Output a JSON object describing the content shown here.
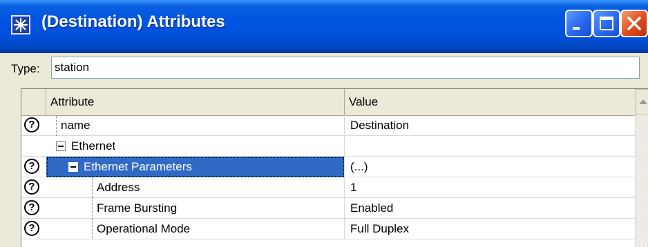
{
  "window": {
    "title": "(Destination) Attributes"
  },
  "type_field": {
    "label": "Type:",
    "value": "station"
  },
  "table": {
    "headers": {
      "attribute": "Attribute",
      "value": "Value"
    },
    "rows": [
      {
        "help": true,
        "indent": 0,
        "expander": false,
        "name": "name",
        "value": "Destination",
        "selected": false
      },
      {
        "help": false,
        "indent": 0,
        "expander": true,
        "name": "Ethernet",
        "value": "",
        "selected": false
      },
      {
        "help": true,
        "indent": 1,
        "expander": true,
        "name": "Ethernet Parameters",
        "value": "(...)",
        "selected": true
      },
      {
        "help": true,
        "indent": 2,
        "expander": false,
        "name": "Address",
        "value": "1",
        "selected": false
      },
      {
        "help": true,
        "indent": 2,
        "expander": false,
        "name": "Frame Bursting",
        "value": "Enabled",
        "selected": false
      },
      {
        "help": true,
        "indent": 2,
        "expander": false,
        "name": "Operational Mode",
        "value": "Full Duplex",
        "selected": false
      }
    ]
  },
  "icons": {
    "app": "asterisk-icon",
    "minimize": "minimize-icon",
    "maximize": "maximize-icon",
    "close": "close-icon",
    "help": "question-mark-icon"
  },
  "colors": {
    "titlebar": "#0054e3",
    "selection": "#316ac5",
    "close_button": "#e04b1c"
  }
}
